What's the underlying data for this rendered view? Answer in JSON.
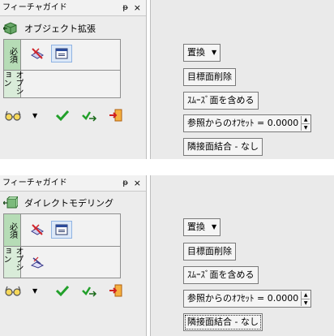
{
  "panels": [
    {
      "title": "フィーチャガイド",
      "pin": "ᵽ",
      "close": "×",
      "mode_icon": "extend-object-icon",
      "mode_label": "オブジェクト拡張",
      "required_label": "必須",
      "optional_label": "オプション",
      "required_tools": [
        "select-object-icon",
        "dialog-window-icon"
      ],
      "optional_tools": [],
      "footer_tools": [
        "glasses-icon",
        "dropdown-arrow",
        "checkmark-icon",
        "apply-next-icon",
        "exit-icon"
      ],
      "right_buttons": {
        "replace": "置換",
        "delete_target": "目標面削除",
        "include_smooth": "ｽﾑｰｽﾞ面を含める",
        "offset_label": "参照からのｵﾌｾｯﾄ =",
        "offset_value": "0.0000",
        "join_adjacent": "隣接面結合 - なし"
      }
    },
    {
      "title": "フィーチャガイド",
      "pin": "ᵽ",
      "close": "×",
      "mode_icon": "direct-modeling-icon",
      "mode_label": "ダイレクトモデリング",
      "required_label": "必須",
      "optional_label": "オプション",
      "required_tools": [
        "select-object-icon",
        "dialog-window-icon"
      ],
      "optional_tools": [
        "select-face-icon"
      ],
      "footer_tools": [
        "glasses-icon",
        "dropdown-arrow",
        "checkmark-icon",
        "apply-next-icon",
        "exit-icon"
      ],
      "right_buttons": {
        "replace": "置換",
        "delete_target": "目標面削除",
        "include_smooth": "ｽﾑｰｽﾞ面を含める",
        "offset_label": "参照からのｵﾌｾｯﾄ =",
        "offset_value": "0.0000",
        "join_adjacent": "隣接面結合 - なし"
      }
    }
  ],
  "colors": {
    "required_tab": "#b6dcb6",
    "optional_tab": "#d9ecd9",
    "check_green": "#22a02a",
    "exit_orange": "#e88a1a"
  }
}
